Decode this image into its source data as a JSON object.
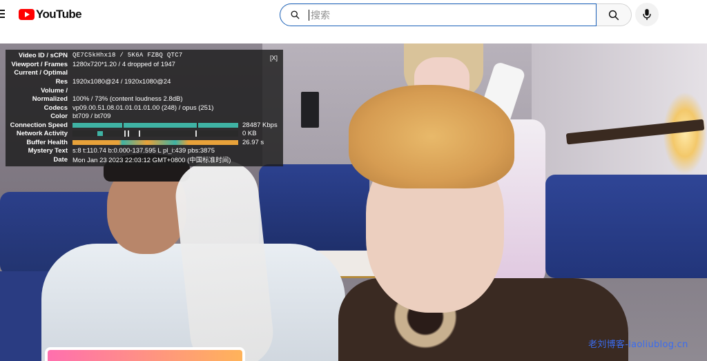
{
  "header": {
    "logo_text": "YouTube",
    "search": {
      "placeholder": "搜索",
      "value": ""
    },
    "icons": [
      "menu-icon",
      "youtube-logo-icon",
      "search-icon",
      "search-button-icon",
      "mic-icon"
    ]
  },
  "stats": {
    "close_label": "[X]",
    "rows": {
      "video_id": {
        "label": "Video ID / sCPN",
        "value": "QE7C5kHhx18 / 5K6A FZBQ QTC7"
      },
      "viewport": {
        "label": "Viewport / Frames",
        "value": "1280x720*1.20 / 4 dropped of 1947"
      },
      "current": {
        "label": "Current / Optimal",
        "value": ""
      },
      "res": {
        "label": "Res",
        "value": "1920x1080@24 / 1920x1080@24"
      },
      "volume": {
        "label": "Volume /",
        "value": ""
      },
      "normalized": {
        "label": "Normalized",
        "value": "100% / 73% (content loudness 2.8dB)"
      },
      "codecs": {
        "label": "Codecs",
        "value": "vp09.00.51.08.01.01.01.01.00 (248) / opus (251)"
      },
      "color": {
        "label": "Color",
        "value": "bt709 / bt709"
      },
      "connection": {
        "label": "Connection Speed",
        "value": "28487 Kbps",
        "fill": 1.0
      },
      "network": {
        "label": "Network Activity",
        "value": "0 KB"
      },
      "buffer": {
        "label": "Buffer Health",
        "value": "26.97 s",
        "fill": 0.9
      },
      "mystery": {
        "label": "Mystery Text",
        "value": "s:8 t:110.74 b:0.000-137.595 L pl_i:439 pbs:3875"
      },
      "date": {
        "label": "Date",
        "value": "Mon Jan 23 2023 22:03:12 GMT+0800 (中国标准时间)"
      }
    }
  },
  "watermark": "老刘博客-laoliublog.cn",
  "colors": {
    "brand_red": "#ff0000",
    "search_border": "#1c62b9",
    "connection_bar": "#3fb3a4",
    "buffer_bar": "#e8a23a",
    "watermark": "#3a6cf0"
  }
}
